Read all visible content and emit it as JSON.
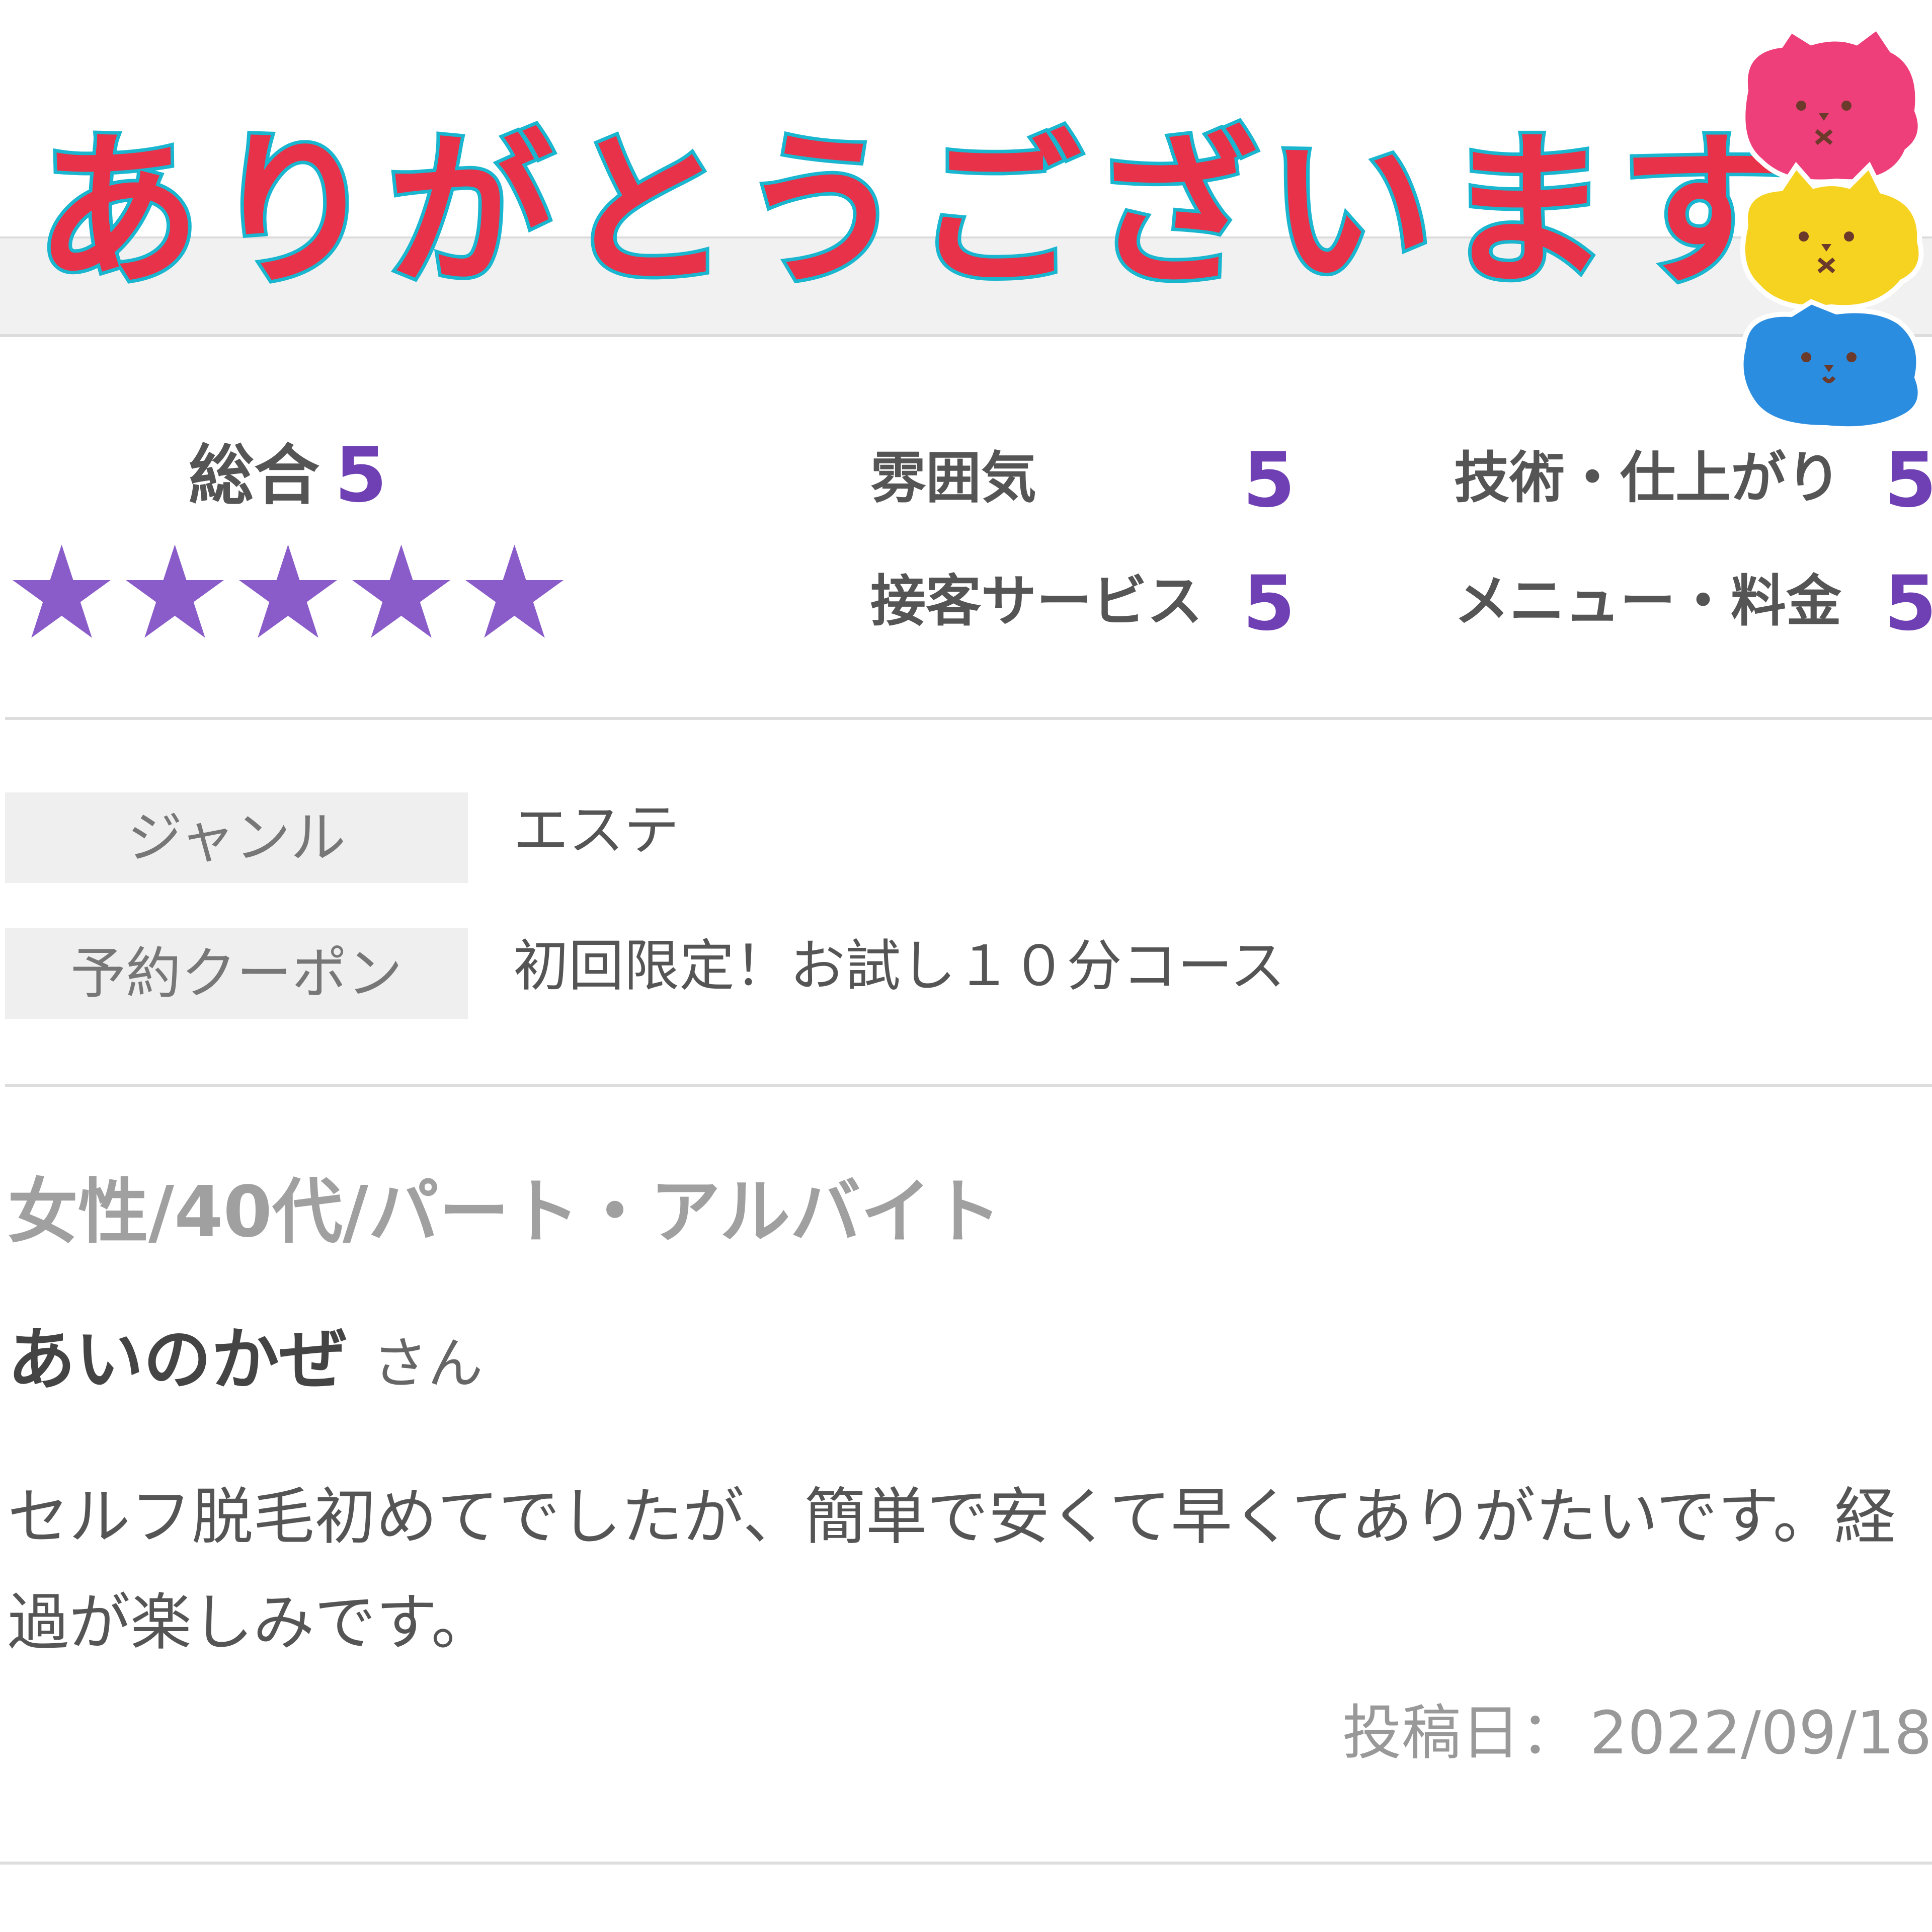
{
  "banner": {
    "text": "ありがとうございます"
  },
  "rating": {
    "overall_label": "総合",
    "overall_value": "5",
    "star_count": 5,
    "star_color": "#8a5cc9",
    "categories": [
      {
        "label": "雰囲気",
        "value": "5"
      },
      {
        "label": "技術・仕上がり",
        "value": "5"
      },
      {
        "label": "接客サービス",
        "value": "5"
      },
      {
        "label": "メニュー・料金",
        "value": "5"
      }
    ]
  },
  "info": {
    "genre_label": "ジャンル",
    "genre_value": "エステ",
    "coupon_label": "予約クーポン",
    "coupon_value": "初回限定！お試し１０分コース"
  },
  "review": {
    "reviewer_meta": "女性/40代/パート・アルバイト",
    "reviewer_name": "あいのかぜ",
    "reviewer_suffix": "さん",
    "comment": "セルフ脱毛初めてでしたが、簡単で安くて早くてありがたいです。経過が楽しみです。",
    "posted_label": "投稿日：",
    "posted_date": "2022/09/18"
  },
  "colors": {
    "accent_purple": "#6f3fb4",
    "banner_red": "#e8324a",
    "banner_outline": "#1ab6cf"
  }
}
